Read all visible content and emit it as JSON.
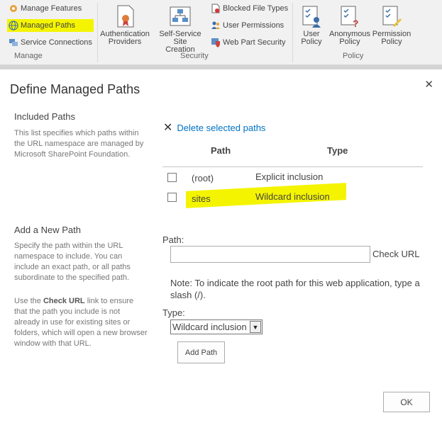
{
  "ribbon": {
    "manage": {
      "manage_features": "Manage Features",
      "managed_paths": "Managed Paths",
      "service_connections": "Service Connections",
      "group_label": "Manage"
    },
    "security": {
      "auth_providers_line1": "Authentication",
      "auth_providers_line2": "Providers",
      "self_service_line1": "Self-Service Site",
      "self_service_line2": "Creation",
      "blocked_file_types": "Blocked File Types",
      "user_permissions": "User Permissions",
      "web_part_security": "Web Part Security",
      "group_label": "Security"
    },
    "policy": {
      "user_policy_line1": "User",
      "user_policy_line2": "Policy",
      "anon_policy_line1": "Anonymous",
      "anon_policy_line2": "Policy",
      "perm_policy_line1": "Permission",
      "perm_policy_line2": "Policy",
      "group_label": "Policy"
    }
  },
  "dialog": {
    "title": "Define Managed Paths",
    "close_glyph": "✕",
    "included": {
      "heading": "Included Paths",
      "description": "This list specifies which paths within the URL namespace are managed by Microsoft SharePoint Foundation.",
      "delete_link": "Delete selected paths",
      "col_path": "Path",
      "col_type": "Type",
      "rows": [
        {
          "path": "(root)",
          "type": "Explicit inclusion"
        },
        {
          "path": "sites",
          "type": "Wildcard inclusion"
        }
      ]
    },
    "add": {
      "heading": "Add a New Path",
      "desc1": "Specify the path within the URL namespace to include. You can include an exact path, or all paths subordinate to the specified path.",
      "desc2_pre": "Use the ",
      "desc2_bold": "Check URL",
      "desc2_post": " link to ensure that the path you include is not already in use for existing sites or folders, which will open a new browser window with that URL.",
      "path_label": "Path:",
      "path_value": "",
      "check_url": "Check URL",
      "note": "Note: To indicate the root path for this web application, type a slash (/).",
      "type_label": "Type:",
      "type_selected": "Wildcard inclusion",
      "add_button": "Add Path"
    },
    "ok_button": "OK"
  }
}
